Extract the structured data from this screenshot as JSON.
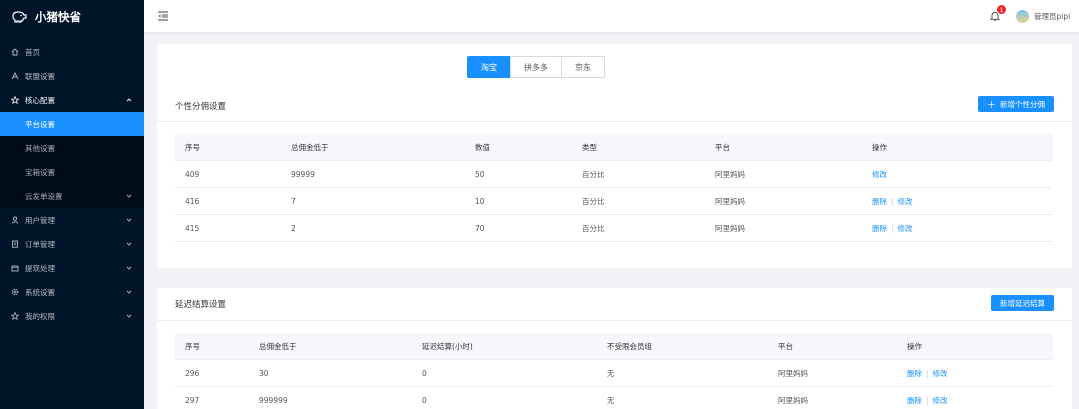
{
  "app": {
    "name": "小猪快省"
  },
  "sidebar": {
    "items": [
      {
        "label": "首页",
        "icon": "home-icon"
      },
      {
        "label": "联盟设置",
        "icon": "union-icon"
      },
      {
        "label": "核心配置",
        "icon": "star-icon",
        "open": true,
        "children": [
          {
            "label": "平台设置",
            "active": true
          },
          {
            "label": "其他设置"
          },
          {
            "label": "宝箱设置"
          },
          {
            "label": "云发单设置",
            "has_children": true
          }
        ]
      },
      {
        "label": "用户管理",
        "icon": "user-icon"
      },
      {
        "label": "订单管理",
        "icon": "order-icon"
      },
      {
        "label": "提现处理",
        "icon": "withdraw-icon"
      },
      {
        "label": "系统设置",
        "icon": "gear-icon"
      },
      {
        "label": "我的权限",
        "icon": "permission-star-icon"
      }
    ]
  },
  "header": {
    "notification_count": "1",
    "username": "管理员pipi"
  },
  "platform_tabs": [
    "淘宝",
    "拼多多",
    "京东"
  ],
  "personal_commission": {
    "title": "个性分佣设置",
    "add_label": "新增个性分佣",
    "columns": [
      "序号",
      "总佣金低于",
      "数值",
      "类型",
      "平台",
      "操作"
    ],
    "rows": [
      {
        "id": "409",
        "threshold": "99999",
        "value": "50",
        "type": "百分比",
        "platform": "阿里妈妈",
        "ops": [
          "修改"
        ]
      },
      {
        "id": "416",
        "threshold": "7",
        "value": "10",
        "type": "百分比",
        "platform": "阿里妈妈",
        "ops": [
          "删除",
          "修改"
        ]
      },
      {
        "id": "415",
        "threshold": "2",
        "value": "70",
        "type": "百分比",
        "platform": "阿里妈妈",
        "ops": [
          "删除",
          "修改"
        ]
      }
    ]
  },
  "delayed_settlement": {
    "title": "延迟结算设置",
    "add_label": "新增延迟结算",
    "columns": [
      "序号",
      "总佣金低于",
      "延迟结算(小时)",
      "不受限会员组",
      "平台",
      "操作"
    ],
    "rows": [
      {
        "id": "296",
        "threshold": "30",
        "delay": "0",
        "group": "无",
        "platform": "阿里妈妈",
        "ops": [
          "删除",
          "修改"
        ]
      },
      {
        "id": "297",
        "threshold": "999999",
        "delay": "0",
        "group": "无",
        "platform": "阿里妈妈",
        "ops": [
          "删除",
          "修改"
        ]
      }
    ]
  },
  "colors": {
    "sidebar_bg": "#001529",
    "primary": "#1890ff",
    "badge": "#f5222d"
  }
}
